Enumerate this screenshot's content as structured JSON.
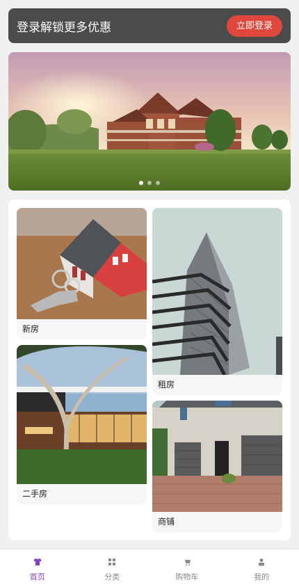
{
  "login_bar": {
    "title": "登录解锁更多优惠",
    "button": "立即登录"
  },
  "banner": {
    "slide_count": 3,
    "active_index": 0
  },
  "categories": [
    {
      "label": "新房"
    },
    {
      "label": "租房"
    },
    {
      "label": "二手房"
    },
    {
      "label": "商铺"
    }
  ],
  "tabbar": {
    "items": [
      {
        "label": "首页",
        "icon": "shirt-icon",
        "active": true
      },
      {
        "label": "分类",
        "icon": "grid-icon",
        "active": false
      },
      {
        "label": "购物车",
        "icon": "cart-icon",
        "active": false
      },
      {
        "label": "我的",
        "icon": "user-icon",
        "active": false
      }
    ],
    "active_color": "#8a3ec0",
    "inactive_color": "#8a8a8a"
  },
  "colors": {
    "login_bg": "#4b4b4b",
    "login_button": "#e0473c"
  }
}
